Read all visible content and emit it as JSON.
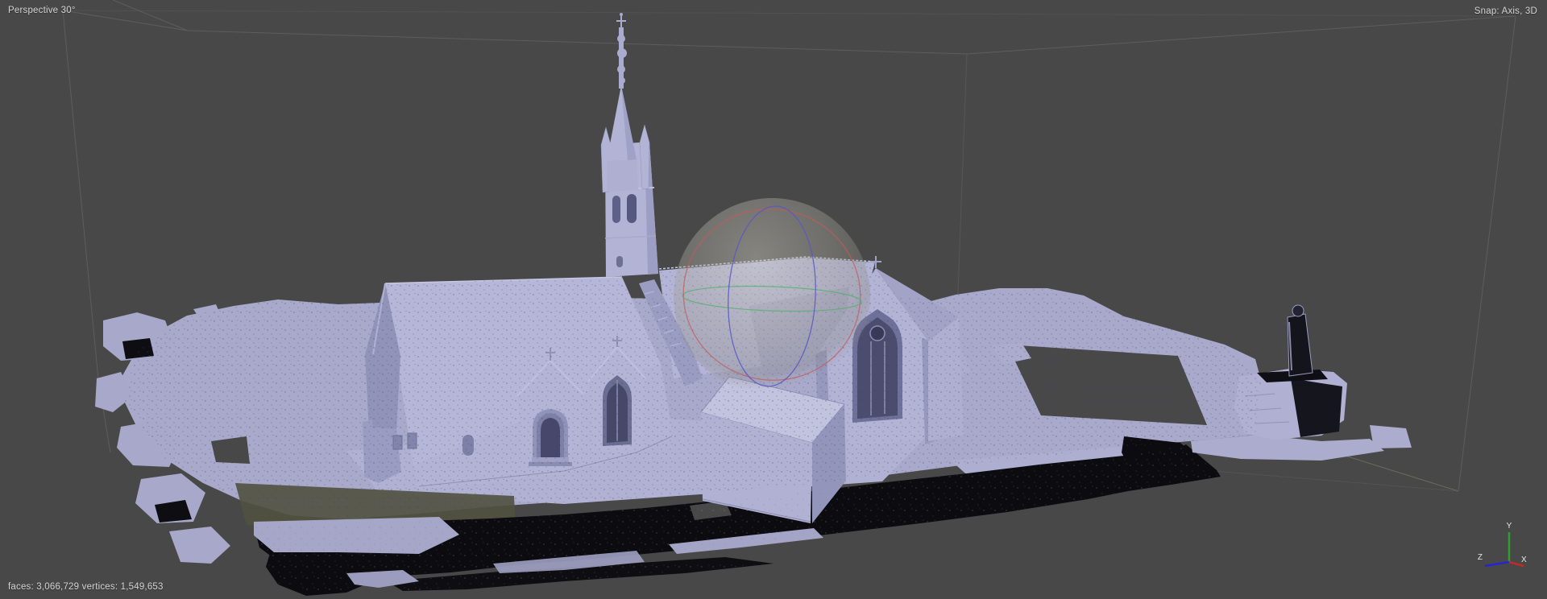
{
  "hud": {
    "projection": "Perspective 30°",
    "snap": "Snap: Axis, 3D",
    "stats": "faces: 3,066,729 vertices: 1,549,653"
  },
  "axis_gizmo": {
    "x_label": "X",
    "y_label": "Y",
    "z_label": "Z",
    "x_color": "#c22a2a",
    "y_color": "#2f9e2f",
    "z_color": "#2626cc"
  },
  "manipulator": {
    "description": "rotation-trackball-sphere",
    "ring_red": "#c35b5b",
    "ring_green": "#55af6e",
    "ring_blue": "#5757c8"
  },
  "scene": {
    "object": "church-photogrammetry-mesh",
    "colors": {
      "background": "#484848",
      "wireframe": "#5d5d5d",
      "mesh_light": "#b6b7d8",
      "mesh_wall": "#b2b3d5",
      "mesh_shade": "#9698be",
      "mesh_dark": "#6e7094",
      "terrain": "#a9aacb",
      "void_black": "#0b0b10",
      "hud_text": "#d4d4d4"
    }
  }
}
